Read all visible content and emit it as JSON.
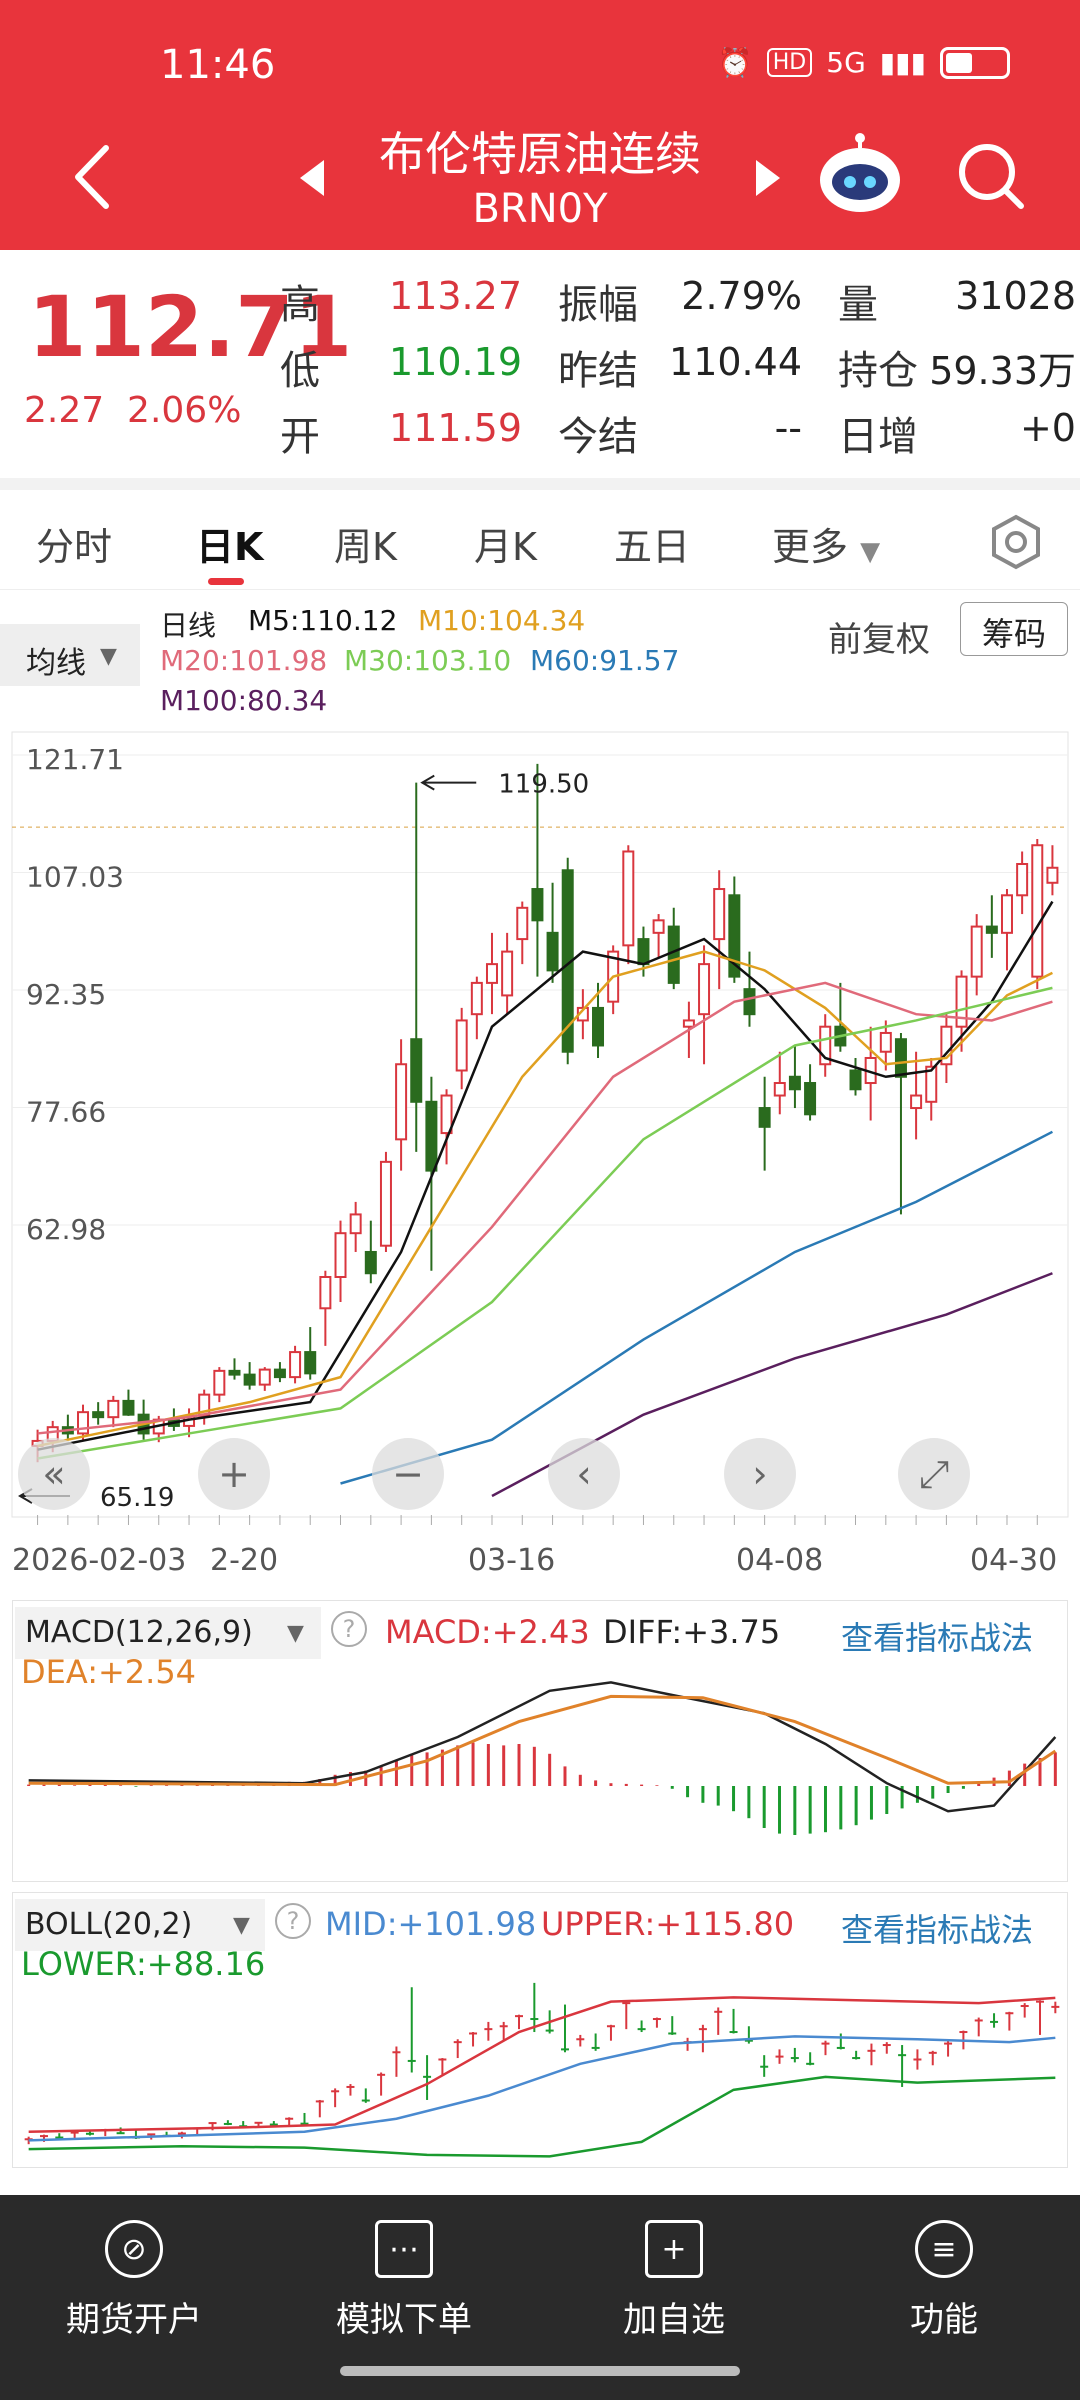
{
  "status": {
    "time": "11:46",
    "hd": "HD",
    "net": "5G"
  },
  "header": {
    "title": "布伦特原油连续",
    "code": "BRN0Y"
  },
  "quote": {
    "price": "112.71",
    "change": "2.27",
    "change_pct": "2.06%",
    "high_label": "高",
    "high": "113.27",
    "low_label": "低",
    "low": "110.19",
    "open_label": "开",
    "open": "111.59",
    "amp_label": "振幅",
    "amp": "2.79%",
    "prev_close_label": "昨结",
    "prev_close": "110.44",
    "settle_label": "今结",
    "settle": "--",
    "vol_label": "量",
    "vol": "31028",
    "oi_label": "持仓",
    "oi": "59.33万",
    "day_inc_label": "日增",
    "day_inc": "+0"
  },
  "tabs": [
    "分时",
    "日K",
    "周K",
    "月K",
    "五日",
    "更多"
  ],
  "active_tab": 1,
  "ma": {
    "selector": "均线",
    "period": "日线",
    "m5": "M5:110.12",
    "m10": "M10:104.34",
    "m20": "M20:101.98",
    "m30": "M30:103.10",
    "m60": "M60:91.57",
    "m100": "M100:80.34",
    "adjust": "前复权",
    "chips": "筹码"
  },
  "colors": {
    "up": "#d9363e",
    "down": "#2a6b1e",
    "m5": "#111111",
    "m10": "#e0a020",
    "m20": "#e06a7a",
    "m30": "#7ccc55",
    "m60": "#2a7ab5",
    "m100": "#5a1f5e"
  },
  "chart_data": {
    "type": "candlestick",
    "y_ticks": [
      "121.71",
      "107.03",
      "92.35",
      "77.66",
      "62.98"
    ],
    "ylim": [
      62.98,
      121.71
    ],
    "x_labels": [
      "2026-02-03",
      "2-20",
      "03-16",
      "04-08",
      "04-30"
    ],
    "max_label": "119.50",
    "min_label": "65.19",
    "candles": [
      [
        66.5,
        67.8,
        65.2,
        66.9
      ],
      [
        66.9,
        68.5,
        66.0,
        68.0
      ],
      [
        68.0,
        69.0,
        67.1,
        67.5
      ],
      [
        67.5,
        69.8,
        67.0,
        69.2
      ],
      [
        69.2,
        70.0,
        68.2,
        68.8
      ],
      [
        68.8,
        70.5,
        68.0,
        70.1
      ],
      [
        70.1,
        71.0,
        68.9,
        69.0
      ],
      [
        69.0,
        70.2,
        67.0,
        67.5
      ],
      [
        67.5,
        68.9,
        66.8,
        68.6
      ],
      [
        68.6,
        69.5,
        67.7,
        68.1
      ],
      [
        68.1,
        69.5,
        67.2,
        68.9
      ],
      [
        68.9,
        71.0,
        68.2,
        70.6
      ],
      [
        70.6,
        72.8,
        70.0,
        72.5
      ],
      [
        72.5,
        73.5,
        71.8,
        72.2
      ],
      [
        72.2,
        73.2,
        71.0,
        71.4
      ],
      [
        71.4,
        72.8,
        70.9,
        72.6
      ],
      [
        72.6,
        73.2,
        71.6,
        72.0
      ],
      [
        72.0,
        74.5,
        71.5,
        74.0
      ],
      [
        74.0,
        76.0,
        71.8,
        72.3
      ],
      [
        77.5,
        80.5,
        74.5,
        80.0
      ],
      [
        80.0,
        84.5,
        78.0,
        83.5
      ],
      [
        83.5,
        86.0,
        82.0,
        85.0
      ],
      [
        82.0,
        84.5,
        79.5,
        80.3
      ],
      [
        82.5,
        90.0,
        82.0,
        89.2
      ],
      [
        91.0,
        99.0,
        88.5,
        97.0
      ],
      [
        99.0,
        119.5,
        90.0,
        94.0
      ],
      [
        94.0,
        96.0,
        80.5,
        88.5
      ],
      [
        91.5,
        95.0,
        89.0,
        94.5
      ],
      [
        96.5,
        101.5,
        95.0,
        100.5
      ],
      [
        101.0,
        104.0,
        99.0,
        103.5
      ],
      [
        103.5,
        107.5,
        101.0,
        105.0
      ],
      [
        102.5,
        107.5,
        101.0,
        106.0
      ],
      [
        107.0,
        110.0,
        105.0,
        109.5
      ],
      [
        111.0,
        121.0,
        104.0,
        108.5
      ],
      [
        107.5,
        111.5,
        103.5,
        104.5
      ],
      [
        112.5,
        113.5,
        97.0,
        98.0
      ],
      [
        100.5,
        103.0,
        99.0,
        101.5
      ],
      [
        101.5,
        103.5,
        97.5,
        98.5
      ],
      [
        102.0,
        106.5,
        101.0,
        106.0
      ],
      [
        106.5,
        114.5,
        105.0,
        114.0
      ],
      [
        107.0,
        108.0,
        104.0,
        105.0
      ],
      [
        107.5,
        109.0,
        105.5,
        108.5
      ],
      [
        108.0,
        109.5,
        103.0,
        103.5
      ],
      [
        100.0,
        102.0,
        97.5,
        100.5
      ],
      [
        101.0,
        106.5,
        97.0,
        105.0
      ],
      [
        107.0,
        112.5,
        103.0,
        111.0
      ],
      [
        110.5,
        112.0,
        103.5,
        104.0
      ],
      [
        103.0,
        106.0,
        100.0,
        101.0
      ],
      [
        93.5,
        96.0,
        88.5,
        92.0
      ],
      [
        94.5,
        98.0,
        93.0,
        95.5
      ],
      [
        96.0,
        98.5,
        93.5,
        95.0
      ],
      [
        95.5,
        97.0,
        92.5,
        93.0
      ],
      [
        97.0,
        101.0,
        96.0,
        100.0
      ],
      [
        100.0,
        103.5,
        98.0,
        98.5
      ],
      [
        96.5,
        97.5,
        94.5,
        95.0
      ],
      [
        95.5,
        100.0,
        92.5,
        97.5
      ],
      [
        98.0,
        100.5,
        96.5,
        99.5
      ],
      [
        99.0,
        99.5,
        85.0,
        96.0
      ],
      [
        93.5,
        98.0,
        91.0,
        94.5
      ],
      [
        94.0,
        97.5,
        92.5,
        96.8
      ],
      [
        97.0,
        101.0,
        95.5,
        100.0
      ],
      [
        100.0,
        104.5,
        98.0,
        104.0
      ],
      [
        104.0,
        109.0,
        102.5,
        108.0
      ],
      [
        108.0,
        110.5,
        105.5,
        107.5
      ],
      [
        107.5,
        111.0,
        104.5,
        110.5
      ],
      [
        110.5,
        114.0,
        109.0,
        113.0
      ],
      [
        104.0,
        115.0,
        103.0,
        114.5
      ],
      [
        111.5,
        114.5,
        110.5,
        112.7
      ]
    ],
    "ma_series": {
      "m5": [
        [
          0,
          66.2
        ],
        [
          10,
          68.6
        ],
        [
          18,
          70.0
        ],
        [
          24,
          82.0
        ],
        [
          30,
          100.0
        ],
        [
          36,
          106.0
        ],
        [
          40,
          105.0
        ],
        [
          44,
          107.0
        ],
        [
          48,
          103.0
        ],
        [
          52,
          97.5
        ],
        [
          56,
          96.0
        ],
        [
          59,
          96.5
        ],
        [
          63,
          102.0
        ],
        [
          67,
          110.0
        ]
      ],
      "m10": [
        [
          0,
          66.5
        ],
        [
          14,
          70.0
        ],
        [
          20,
          72.0
        ],
        [
          26,
          84.0
        ],
        [
          32,
          96.0
        ],
        [
          38,
          104.0
        ],
        [
          44,
          106.0
        ],
        [
          48,
          104.5
        ],
        [
          52,
          101.5
        ],
        [
          56,
          97.0
        ],
        [
          60,
          97.5
        ],
        [
          64,
          102.5
        ],
        [
          67,
          104.3
        ]
      ],
      "m20": [
        [
          0,
          67.5
        ],
        [
          10,
          68.8
        ],
        [
          20,
          71.0
        ],
        [
          30,
          84.0
        ],
        [
          38,
          96.0
        ],
        [
          46,
          102.0
        ],
        [
          52,
          103.5
        ],
        [
          58,
          101.0
        ],
        [
          63,
          100.5
        ],
        [
          67,
          102.0
        ]
      ],
      "m30": [
        [
          0,
          65.5
        ],
        [
          10,
          67.5
        ],
        [
          20,
          69.5
        ],
        [
          30,
          78.0
        ],
        [
          40,
          91.0
        ],
        [
          50,
          98.5
        ],
        [
          58,
          100.5
        ],
        [
          67,
          103.1
        ]
      ],
      "m60": [
        [
          20,
          63.5
        ],
        [
          30,
          67.0
        ],
        [
          40,
          75.0
        ],
        [
          50,
          82.0
        ],
        [
          58,
          86.0
        ],
        [
          67,
          91.6
        ]
      ],
      "m100": [
        [
          30,
          62.5
        ],
        [
          40,
          69.0
        ],
        [
          50,
          73.5
        ],
        [
          60,
          77.0
        ],
        [
          67,
          80.3
        ]
      ]
    }
  },
  "macd": {
    "selector": "MACD(12,26,9)",
    "macd": "MACD:+2.43",
    "diff": "DIFF:+3.75",
    "dea": "DEA:+2.54",
    "link": "查看指标战法",
    "hist": [
      0.1,
      0.1,
      0.1,
      0.05,
      0.1,
      0.1,
      0.05,
      -0.05,
      0.05,
      0.05,
      0.1,
      0.1,
      0.15,
      0.2,
      0.2,
      0.2,
      0.25,
      0.3,
      0.3,
      0.5,
      0.8,
      1.0,
      1.1,
      1.4,
      1.8,
      2.3,
      2.4,
      2.6,
      2.9,
      3.1,
      3.0,
      2.9,
      3.0,
      2.8,
      2.3,
      1.4,
      0.8,
      0.4,
      0.2,
      0.15,
      0.1,
      0.05,
      -0.2,
      -0.8,
      -1.2,
      -1.4,
      -1.8,
      -2.3,
      -3.0,
      -3.4,
      -3.5,
      -3.4,
      -3.3,
      -3.1,
      -2.8,
      -2.4,
      -2.0,
      -1.6,
      -1.2,
      -0.9,
      -0.5,
      -0.2,
      0.2,
      0.6,
      1.1,
      1.6,
      2.0,
      2.4
    ],
    "diff_series": [
      [
        0,
        0.4
      ],
      [
        18,
        0.2
      ],
      [
        22,
        1.0
      ],
      [
        28,
        3.5
      ],
      [
        34,
        6.8
      ],
      [
        38,
        7.4
      ],
      [
        42,
        6.5
      ],
      [
        48,
        5.2
      ],
      [
        52,
        3.0
      ],
      [
        56,
        0.2
      ],
      [
        60,
        -1.8
      ],
      [
        63,
        -1.4
      ],
      [
        67,
        3.5
      ]
    ],
    "dea_series": [
      [
        0,
        0.2
      ],
      [
        20,
        0.1
      ],
      [
        26,
        1.8
      ],
      [
        32,
        4.6
      ],
      [
        38,
        6.4
      ],
      [
        44,
        6.3
      ],
      [
        50,
        4.6
      ],
      [
        56,
        2.0
      ],
      [
        60,
        0.2
      ],
      [
        64,
        0.3
      ],
      [
        67,
        2.5
      ]
    ]
  },
  "boll": {
    "selector": "BOLL(20,2)",
    "mid": "MID:+101.98",
    "upper": "UPPER:+115.80",
    "lower": "LOWER:+88.16",
    "link": "查看指标战法",
    "upper_series": [
      [
        0,
        69.5
      ],
      [
        14,
        71.0
      ],
      [
        20,
        72.0
      ],
      [
        26,
        86.0
      ],
      [
        32,
        104.0
      ],
      [
        38,
        114.5
      ],
      [
        46,
        116.0
      ],
      [
        54,
        115.0
      ],
      [
        62,
        114.0
      ],
      [
        67,
        115.8
      ]
    ],
    "mid_series": [
      [
        0,
        66.5
      ],
      [
        18,
        69.5
      ],
      [
        24,
        74.0
      ],
      [
        30,
        82.0
      ],
      [
        36,
        93.0
      ],
      [
        42,
        100.0
      ],
      [
        50,
        102.5
      ],
      [
        58,
        101.5
      ],
      [
        64,
        100.5
      ],
      [
        67,
        102.0
      ]
    ],
    "lower_series": [
      [
        0,
        63.5
      ],
      [
        10,
        64.5
      ],
      [
        18,
        64.0
      ],
      [
        26,
        61.5
      ],
      [
        34,
        61.0
      ],
      [
        40,
        66.0
      ],
      [
        46,
        84.0
      ],
      [
        52,
        88.5
      ],
      [
        58,
        86.5
      ],
      [
        67,
        88.2
      ]
    ]
  },
  "controls": [
    "«",
    "+",
    "−",
    "‹",
    "›",
    "⤢"
  ],
  "nav": [
    {
      "icon": "⊘",
      "label": "期货开户"
    },
    {
      "icon": "⋯",
      "label": "模拟下单"
    },
    {
      "icon": "+",
      "label": "加自选"
    },
    {
      "icon": "≡",
      "label": "功能"
    }
  ]
}
